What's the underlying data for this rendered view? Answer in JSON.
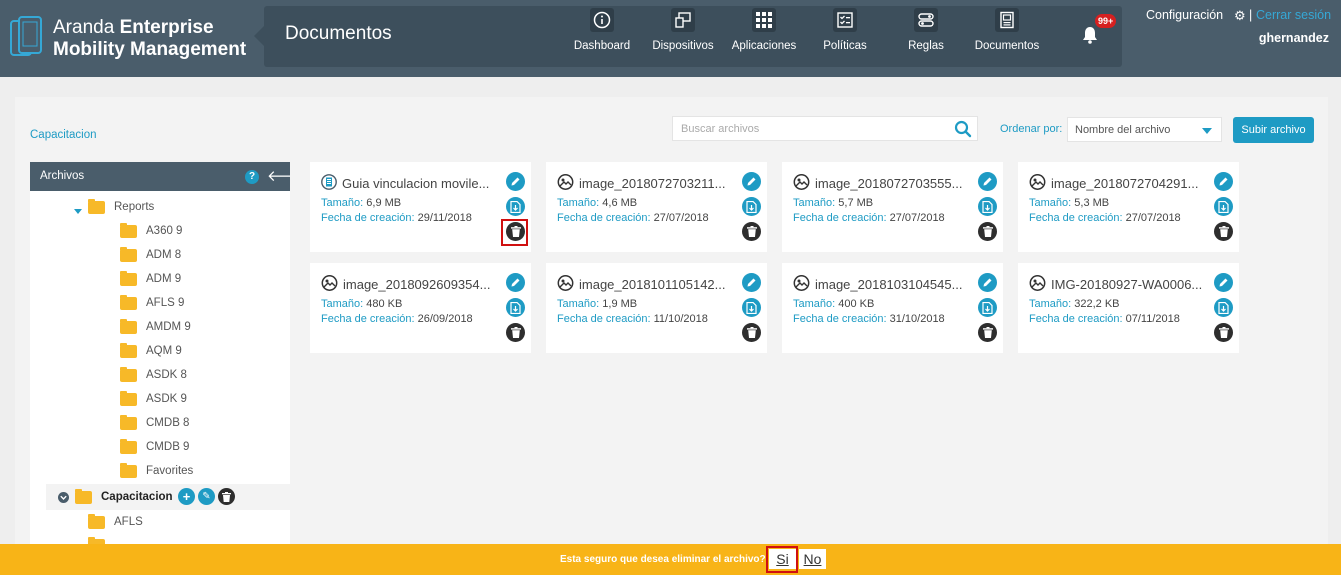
{
  "header": {
    "brand_light": "Aranda",
    "brand_bold_1": "Enterprise",
    "brand_bold_2": "Mobility Management",
    "page_title": "Documentos",
    "nav": [
      {
        "label": "Dashboard",
        "icon": "info-icon"
      },
      {
        "label": "Dispositivos",
        "icon": "devices-icon"
      },
      {
        "label": "Aplicaciones",
        "icon": "apps-grid-icon"
      },
      {
        "label": "Políticas",
        "icon": "policies-icon"
      },
      {
        "label": "Reglas",
        "icon": "rules-icon"
      },
      {
        "label": "Documentos",
        "icon": "documents-icon"
      }
    ],
    "notifications_badge": "99+",
    "config_label": "Configuración",
    "separator": "|",
    "logout_label": "Cerrar sesión",
    "username": "ghernandez"
  },
  "toolbar": {
    "breadcrumb": "Capacitacion",
    "search_placeholder": "Buscar archivos",
    "sort_label": "Ordenar por:",
    "sort_value": "Nombre del archivo",
    "upload_label": "Subir archivo"
  },
  "sidebar": {
    "title": "Archivos",
    "help": "?",
    "tree": {
      "reports": "Reports",
      "children": [
        "A360 9",
        "ADM 8",
        "ADM 9",
        "AFLS 9",
        "AMDM 9",
        "AQM 9",
        "ASDK 8",
        "ASDK 9",
        "CMDB 8",
        "CMDB 9",
        "Favorites"
      ],
      "capacitacion": "Capacitacion",
      "cap_children": [
        "AFLS"
      ]
    }
  },
  "files": [
    {
      "name": "Guia vinculacion movile...",
      "size": "6,9 MB",
      "date": "29/11/2018",
      "type": "document"
    },
    {
      "name": "image_2018072703211...",
      "size": "4,6 MB",
      "date": "27/07/2018",
      "type": "image"
    },
    {
      "name": "image_2018072703555...",
      "size": "5,7 MB",
      "date": "27/07/2018",
      "type": "image"
    },
    {
      "name": "image_2018072704291...",
      "size": "5,3 MB",
      "date": "27/07/2018",
      "type": "image"
    },
    {
      "name": "image_2018092609354...",
      "size": "480 KB",
      "date": "26/09/2018",
      "type": "image"
    },
    {
      "name": "image_2018101105142...",
      "size": "1,9 MB",
      "date": "11/10/2018",
      "type": "image"
    },
    {
      "name": "image_2018103104545...",
      "size": "400 KB",
      "date": "31/10/2018",
      "type": "image"
    },
    {
      "name": "IMG-20180927-WA0006...",
      "size": "322,2 KB",
      "date": "07/11/2018",
      "type": "image"
    }
  ],
  "labels": {
    "size": "Tamaño:",
    "date": "Fecha de creación:"
  },
  "confirm": {
    "message": "Esta seguro que desea eliminar el archivo?:",
    "yes": "Si",
    "no": "No"
  },
  "colors": {
    "header": "#4a5d6b",
    "accent": "#1e9bc4",
    "folder": "#f7b928",
    "confirm_bar": "#f8b417",
    "highlight": "#d01010"
  }
}
